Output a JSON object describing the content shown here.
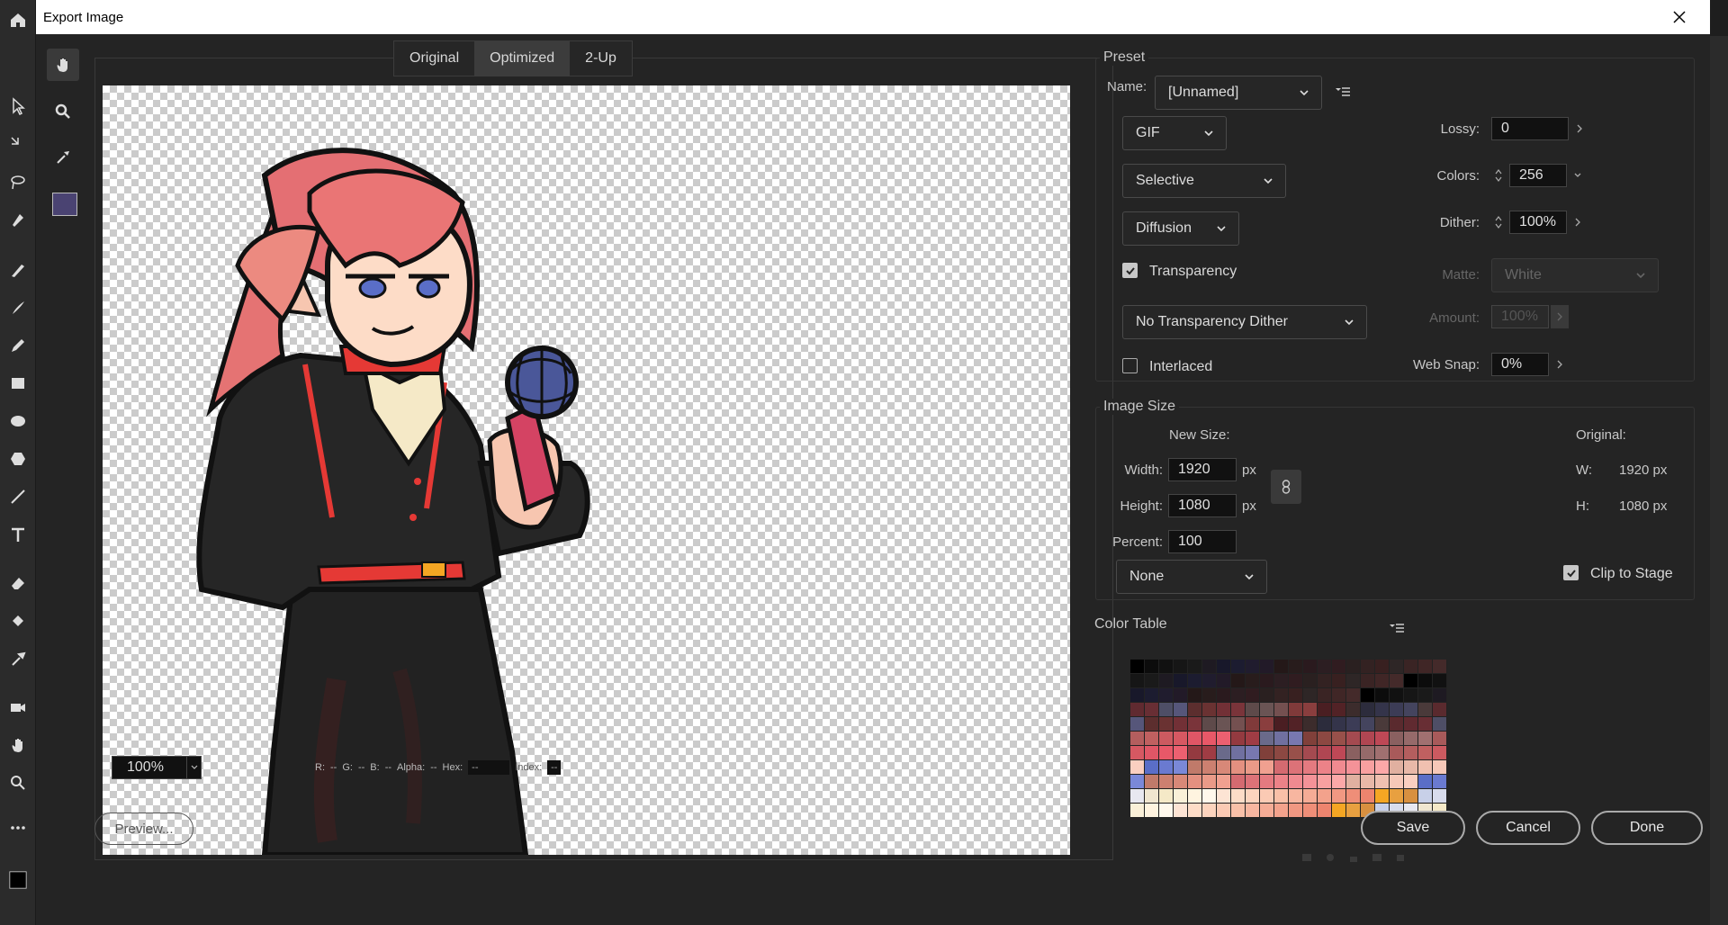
{
  "window": {
    "title": "Export Image"
  },
  "view_tabs": [
    {
      "label": "Original"
    },
    {
      "label": "Optimized"
    },
    {
      "label": "2-Up"
    }
  ],
  "preview": {
    "zoom": "100%",
    "pixel_info": {
      "r_label": "R:",
      "r_value": "--",
      "g_label": "G:",
      "g_value": "--",
      "b_label": "B:",
      "b_value": "--",
      "alpha_label": "Alpha:",
      "alpha_value": "--",
      "hex_label": "Hex:",
      "hex_value": "--",
      "index_label": "Index:",
      "index_value": "--"
    },
    "preview_button": "Preview..."
  },
  "tools": {
    "swatch_color": "#4a4372"
  },
  "preset": {
    "title": "Preset",
    "name_label": "Name:",
    "name_value": "[Unnamed]",
    "format": "GIF",
    "palette": "Selective",
    "dither_method": "Diffusion",
    "transparency_label": "Transparency",
    "transparency_checked": true,
    "transparency_dither": "No Transparency Dither",
    "interlaced_label": "Interlaced",
    "interlaced_checked": false,
    "lossy_label": "Lossy:",
    "lossy_value": "0",
    "colors_label": "Colors:",
    "colors_value": "256",
    "dither_label": "Dither:",
    "dither_value": "100%",
    "matte_label": "Matte:",
    "matte_value": "White",
    "amount_label": "Amount:",
    "amount_value": "100%",
    "websnap_label": "Web Snap:",
    "websnap_value": "0%"
  },
  "image_size": {
    "title": "Image Size",
    "new_size_label": "New Size:",
    "width_label": "Width:",
    "width_value": "1920",
    "height_label": "Height:",
    "height_value": "1080",
    "unit": "px",
    "percent_label": "Percent:",
    "percent_value": "100",
    "resample": "None",
    "original_label": "Original:",
    "orig_w_label": "W:",
    "orig_w_value": "1920 px",
    "orig_h_label": "H:",
    "orig_h_value": "1080 px",
    "clip_label": "Clip to Stage",
    "clip_checked": true
  },
  "color_table": {
    "title": "Color Table"
  },
  "buttons": {
    "save": "Save",
    "cancel": "Cancel",
    "done": "Done"
  }
}
